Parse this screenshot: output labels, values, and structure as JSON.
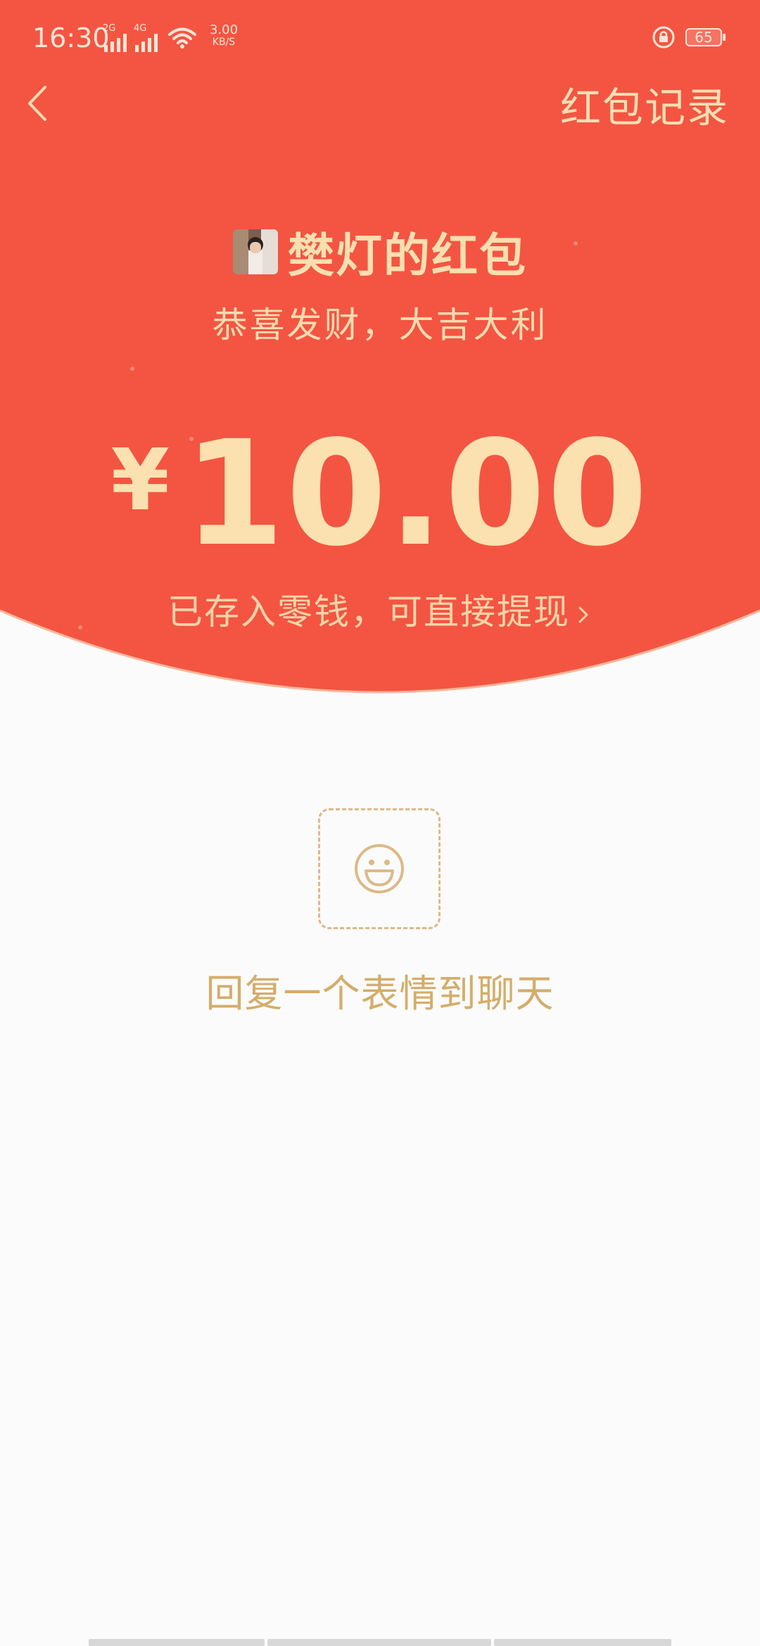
{
  "status_bar": {
    "time": "16:30",
    "network_2g": "2G",
    "network_4g": "4G",
    "speed_value": "3.00",
    "speed_unit": "KB/S",
    "battery_level": "65"
  },
  "nav": {
    "records_label": "红包记录"
  },
  "packet": {
    "sender_name": "樊灯的红包",
    "greeting": "恭喜发财，大吉大利",
    "currency_symbol": "¥",
    "amount": "10.00",
    "stored_text": "已存入零钱，可直接提现"
  },
  "reply": {
    "label": "回复一个表情到聊天"
  },
  "colors": {
    "header_red": "#f35542",
    "gold_text": "#f8dfaf",
    "reply_gold": "#d4ad6a",
    "page_bg": "#fbfbfb"
  },
  "icons": {
    "back": "chevron-left-icon",
    "emoji": "smiley-face-icon",
    "forward": "chevron-right-icon",
    "lock": "rotation-lock-icon",
    "wifi": "wifi-icon",
    "signal": "signal-bars-icon"
  }
}
